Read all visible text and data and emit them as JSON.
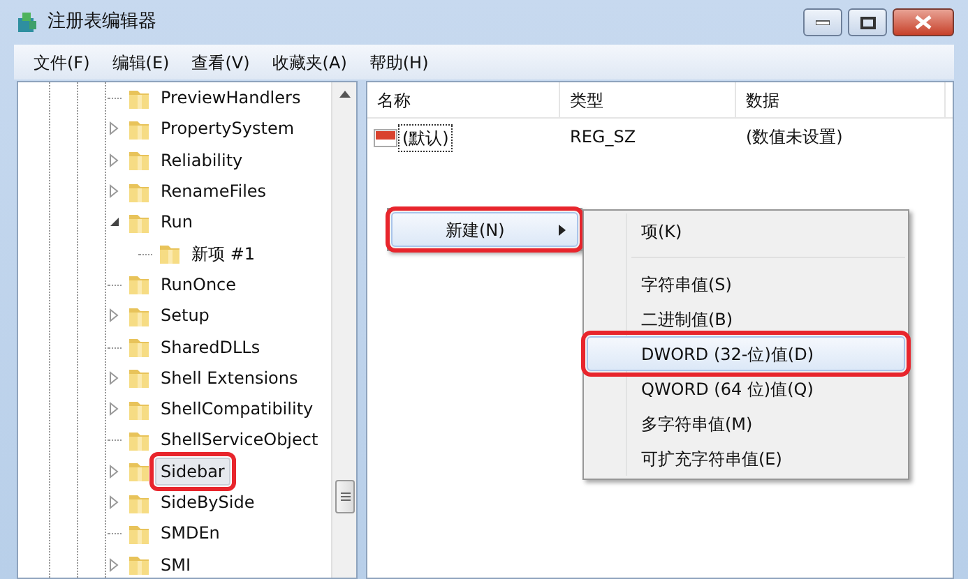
{
  "window": {
    "title": "注册表编辑器"
  },
  "menu_bar": [
    "文件(F)",
    "编辑(E)",
    "查看(V)",
    "收藏夹(A)",
    "帮助(H)"
  ],
  "tree": [
    {
      "label": "PreviewHandlers",
      "kind": "leaf",
      "selected": false,
      "highlighted": false
    },
    {
      "label": "PropertySystem",
      "kind": "collapsed",
      "selected": false,
      "highlighted": false
    },
    {
      "label": "Reliability",
      "kind": "collapsed",
      "selected": false,
      "highlighted": false
    },
    {
      "label": "RenameFiles",
      "kind": "collapsed",
      "selected": false,
      "highlighted": false
    },
    {
      "label": "Run",
      "kind": "expanded",
      "selected": false,
      "highlighted": false,
      "children": [
        {
          "label": "新项 #1",
          "kind": "leaf",
          "selected": false,
          "highlighted": false
        }
      ]
    },
    {
      "label": "RunOnce",
      "kind": "leaf",
      "selected": false,
      "highlighted": false
    },
    {
      "label": "Setup",
      "kind": "collapsed",
      "selected": false,
      "highlighted": false
    },
    {
      "label": "SharedDLLs",
      "kind": "leaf",
      "selected": false,
      "highlighted": false
    },
    {
      "label": "Shell Extensions",
      "kind": "collapsed",
      "selected": false,
      "highlighted": false
    },
    {
      "label": "ShellCompatibility",
      "kind": "collapsed",
      "selected": false,
      "highlighted": false
    },
    {
      "label": "ShellServiceObject",
      "kind": "leaf",
      "selected": false,
      "highlighted": false
    },
    {
      "label": "Sidebar",
      "kind": "collapsed",
      "selected": true,
      "highlighted": true
    },
    {
      "label": "SideBySide",
      "kind": "collapsed",
      "selected": false,
      "highlighted": false
    },
    {
      "label": "SMDEn",
      "kind": "leaf",
      "selected": false,
      "highlighted": false
    },
    {
      "label": "SMI",
      "kind": "collapsed",
      "selected": false,
      "highlighted": false
    }
  ],
  "table": {
    "columns": [
      "名称",
      "类型",
      "数据"
    ],
    "rows": [
      {
        "name": "(默认)",
        "type": "REG_SZ",
        "data": "(数值未设置)"
      }
    ]
  },
  "context_menu": {
    "items": [
      {
        "label": "新建(N)",
        "selected": true,
        "highlighted": true,
        "submenu": true
      }
    ]
  },
  "submenu": {
    "items": [
      {
        "kind": "item",
        "label": "项(K)",
        "selected": false,
        "highlighted": false
      },
      {
        "kind": "separator"
      },
      {
        "kind": "item",
        "label": "字符串值(S)",
        "selected": false,
        "highlighted": false
      },
      {
        "kind": "item",
        "label": "二进制值(B)",
        "selected": false,
        "highlighted": false
      },
      {
        "kind": "item",
        "label": "DWORD (32-位)值(D)",
        "selected": true,
        "highlighted": true
      },
      {
        "kind": "item",
        "label": "QWORD (64 位)值(Q)",
        "selected": false,
        "highlighted": false
      },
      {
        "kind": "item",
        "label": "多字符串值(M)",
        "selected": false,
        "highlighted": false
      },
      {
        "kind": "item",
        "label": "可扩充字符串值(E)",
        "selected": false,
        "highlighted": false
      }
    ]
  }
}
